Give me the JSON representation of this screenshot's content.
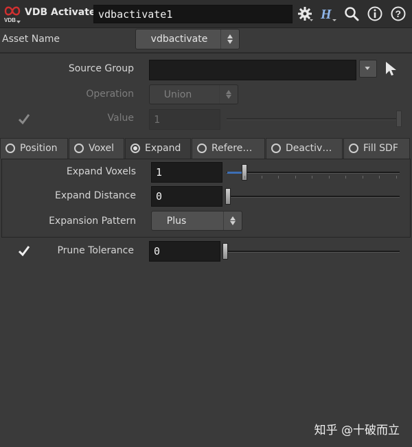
{
  "header": {
    "node_type": "VDB Activate",
    "node_name": "vdbactivate1",
    "logo_text": "VDB",
    "icons": [
      "vdb-logo",
      "gear-icon",
      "houdini-help-icon",
      "search-icon",
      "info-icon",
      "help-icon"
    ]
  },
  "asset": {
    "label": "Asset Name",
    "value": "vdbactivate"
  },
  "source_group": {
    "label": "Source Group",
    "value": ""
  },
  "operation": {
    "label": "Operation",
    "value": "Union"
  },
  "value_param": {
    "label": "Value",
    "value": "1",
    "enabled": true
  },
  "tabs": [
    {
      "label": "Position",
      "active": false
    },
    {
      "label": "Voxel",
      "active": false
    },
    {
      "label": "Expand",
      "active": true
    },
    {
      "label": "Refere…",
      "active": false
    },
    {
      "label": "Deactiv…",
      "active": false
    },
    {
      "label": "Fill SDF",
      "active": false
    }
  ],
  "expand": {
    "voxels_label": "Expand Voxels",
    "voxels_value": "1",
    "distance_label": "Expand Distance",
    "distance_value": "0",
    "pattern_label": "Expansion Pattern",
    "pattern_value": "Plus"
  },
  "prune": {
    "label": "Prune Tolerance",
    "value": "0",
    "enabled": true
  },
  "watermark": "知乎 @十破而立",
  "colors": {
    "background": "#3a3a3a",
    "field": "#1c1c1c",
    "slider_fill": "#3d6fb5",
    "logo_red": "#d03030"
  }
}
